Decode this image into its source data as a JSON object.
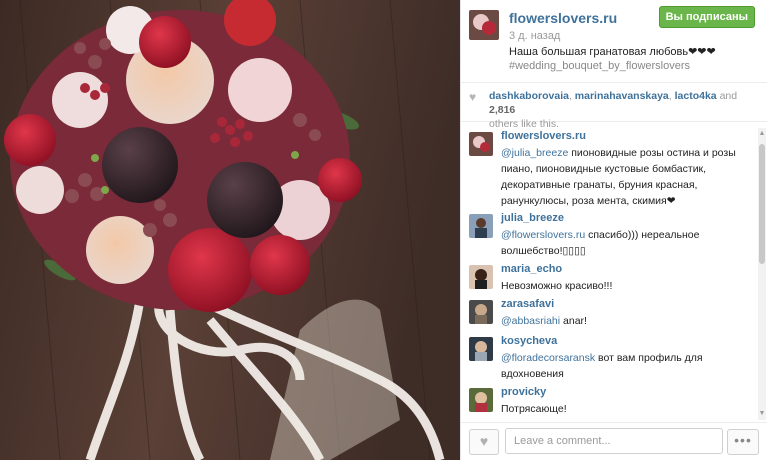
{
  "post": {
    "username": "flowerslovers.ru",
    "age": "3 д. назад",
    "caption": "Наша большая гранатовая любовь❤❤❤",
    "hashtag": "#wedding_bouquet_by_flowerslovers",
    "follow_label": "Вы подписаны"
  },
  "likes": {
    "users": [
      "dashkaborovaia",
      "marinahavanskaya",
      "lacto4ka"
    ],
    "and_text": "and",
    "count": "2,816",
    "others_text": "others like this."
  },
  "comments": [
    {
      "user": "flowerslovers.ru",
      "mention": "@julia_breeze",
      "text": " пионовидные розы остина и розы пиано, пионовидные кустовые бомбастик, декоративные гранаты, бруния красная, ранункулюсы, роза мента, скимия❤"
    },
    {
      "user": "julia_breeze",
      "mention": "@flowerslovers.ru",
      "text": " спасибо))) нереальное волшебство!▯▯▯▯"
    },
    {
      "user": "maria_echo",
      "mention": "",
      "text": "Невозможно красиво!!!"
    },
    {
      "user": "zarasafavi",
      "mention": "@abbasriahi",
      "text": " anar!"
    },
    {
      "user": "kosycheva",
      "mention": "@floradecorsaransk",
      "text": " вот вам профиль для вдохновения"
    },
    {
      "user": "provicky",
      "mention": "",
      "text": "Потрясающе!"
    }
  ],
  "comment_box": {
    "placeholder": "Leave a comment..."
  },
  "footer": {
    "more_label": "•••"
  },
  "colors": {
    "username": "#3f729b",
    "follow_button": "#6bb64a",
    "wood_background": "#5a4036"
  }
}
